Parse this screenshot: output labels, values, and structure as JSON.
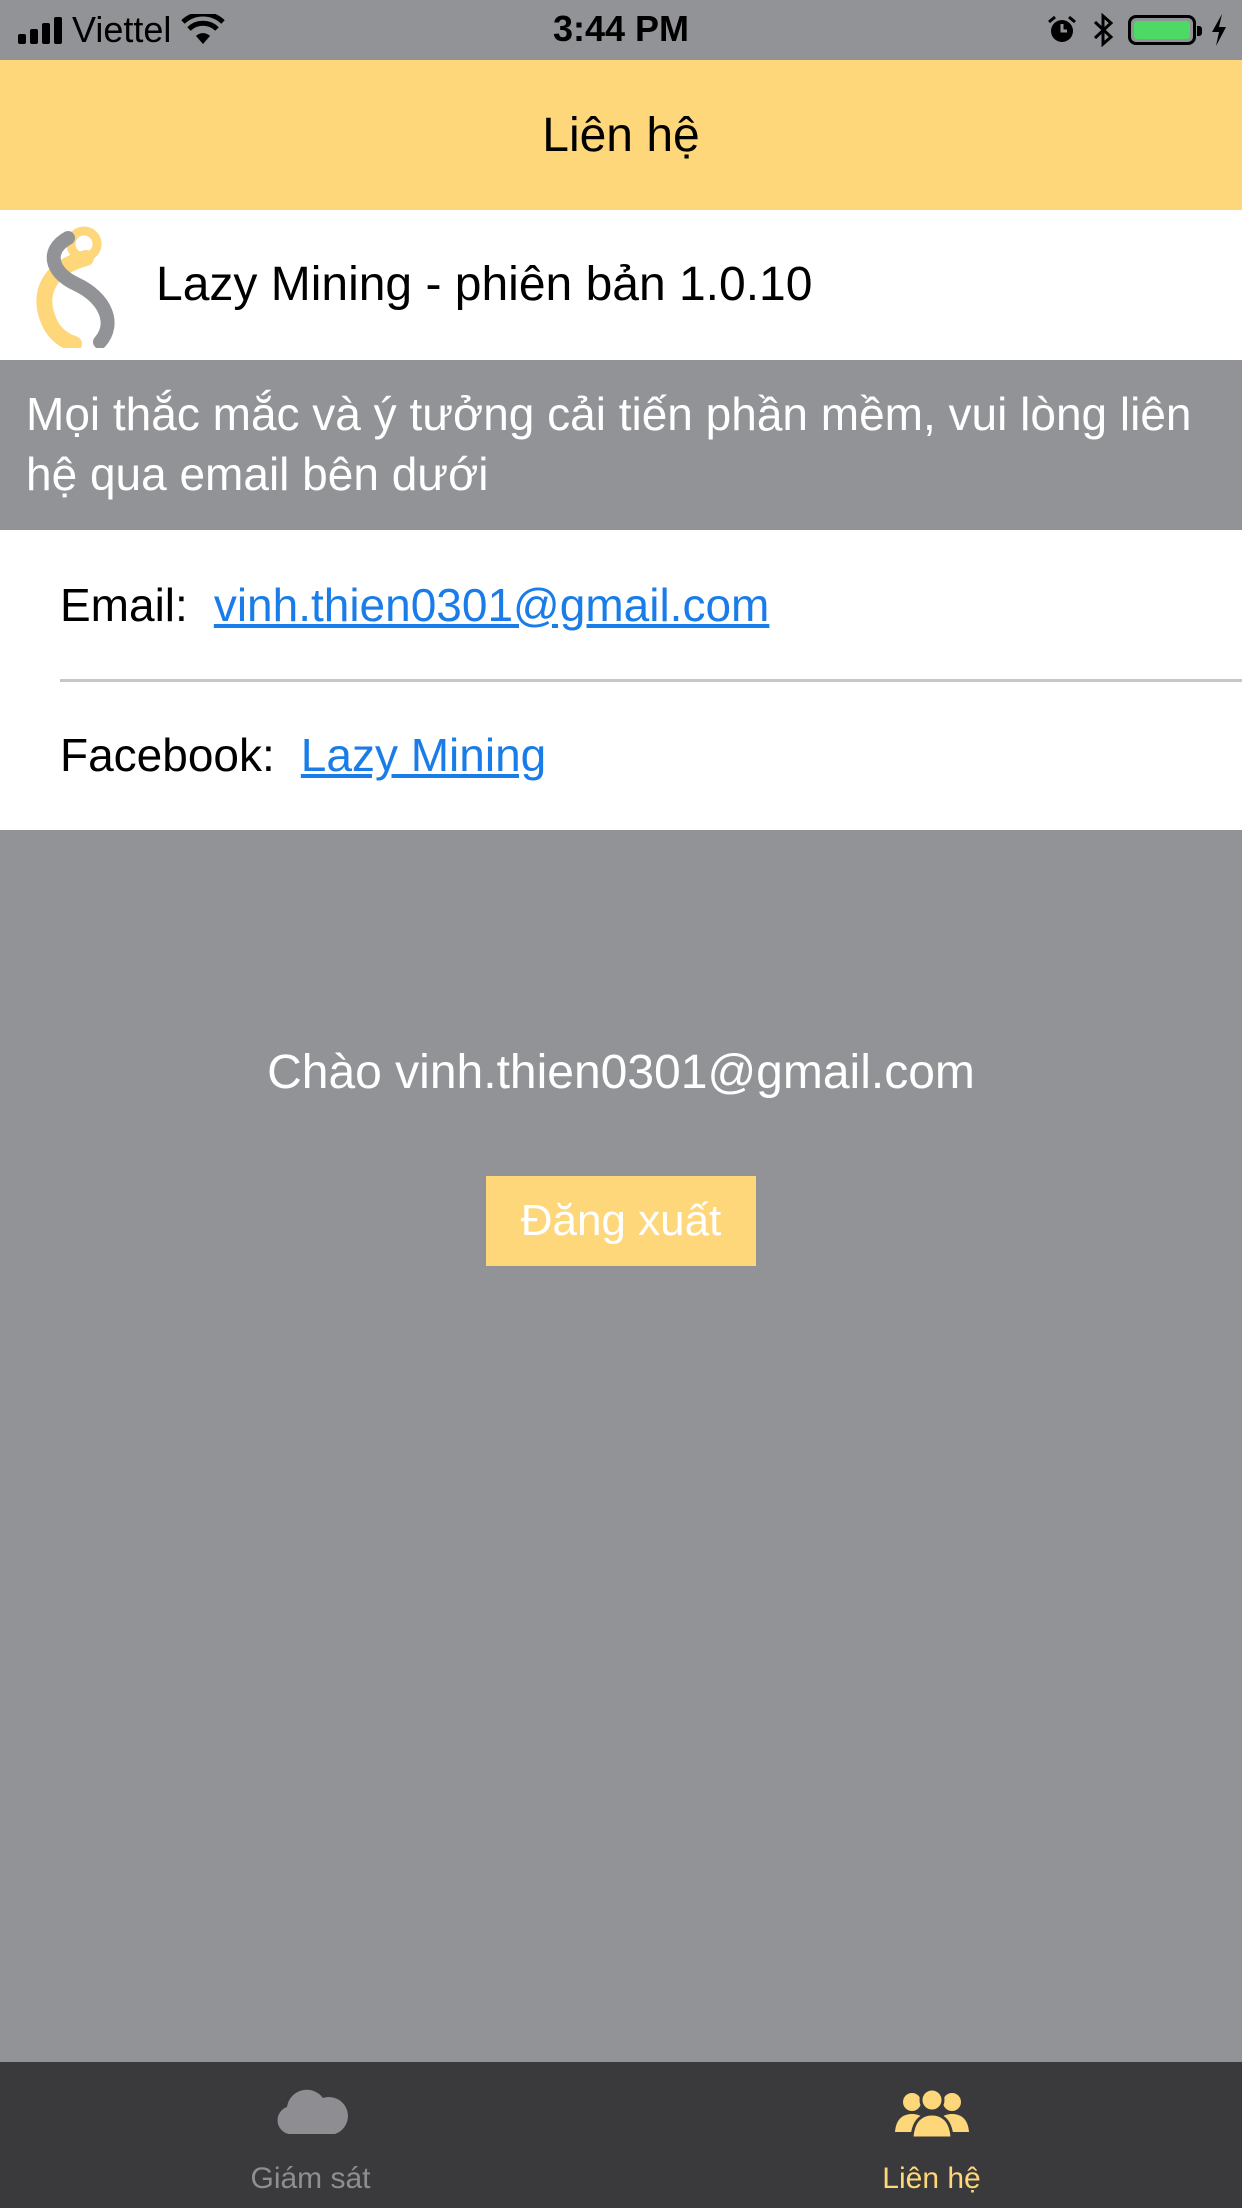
{
  "status_bar": {
    "carrier": "Viettel",
    "time": "3:44 PM"
  },
  "nav": {
    "title": "Liên hệ"
  },
  "app_info": {
    "title": "Lazy Mining - phiên bản 1.0.10"
  },
  "banner": {
    "text": "Mọi thắc mắc và ý tưởng cải tiến phần mềm, vui lòng liên hệ qua email bên dưới"
  },
  "contact": {
    "email_label": "Email:",
    "email_value": "vinh.thien0301@gmail.com",
    "facebook_label": "Facebook:",
    "facebook_value": "Lazy Mining"
  },
  "account": {
    "greeting": "Chào vinh.thien0301@gmail.com",
    "logout_label": "Đăng xuất"
  },
  "tabs": [
    {
      "label": "Giám sát",
      "icon": "cloud-icon",
      "active": false
    },
    {
      "label": "Liên hệ",
      "icon": "people-icon",
      "active": true
    }
  ],
  "colors": {
    "accent": "#fed77a",
    "link": "#1a7ce8",
    "background": "#929397",
    "tab_bar": "#3a3a3c",
    "battery": "#4cd964"
  }
}
